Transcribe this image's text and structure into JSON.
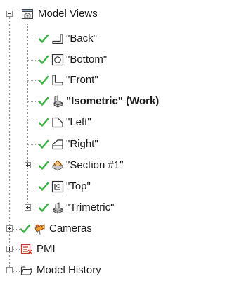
{
  "tree": {
    "model_views": {
      "label": "Model Views",
      "icon": "model-views-icon",
      "expanded": true
    },
    "views": [
      {
        "label": "\"Back\"",
        "icon": "back-view-icon",
        "visible": true
      },
      {
        "label": "\"Bottom\"",
        "icon": "bottom-view-icon",
        "visible": true
      },
      {
        "label": "\"Front\"",
        "icon": "front-view-icon",
        "visible": true
      },
      {
        "label": "\"Isometric\" (Work)",
        "icon": "isometric-view-icon",
        "visible": true,
        "bold": true
      },
      {
        "label": "\"Left\"",
        "icon": "left-view-icon",
        "visible": true
      },
      {
        "label": "\"Right\"",
        "icon": "right-view-icon",
        "visible": true
      },
      {
        "label": "\"Section #1\"",
        "icon": "section-view-icon",
        "visible": true,
        "collapsed": true
      },
      {
        "label": "\"Top\"",
        "icon": "top-view-icon",
        "visible": true
      },
      {
        "label": "\"Trimetric\"",
        "icon": "trimetric-view-icon",
        "visible": true,
        "collapsed": true
      }
    ],
    "cameras": {
      "label": "Cameras",
      "icon": "cameras-icon",
      "visible": true
    },
    "pmi": {
      "label": "PMI",
      "icon": "pmi-icon"
    },
    "model_history": {
      "label": "Model History",
      "icon": "folder-icon"
    }
  },
  "colors": {
    "check": "#3cb043",
    "connector": "#9a9a9a"
  }
}
